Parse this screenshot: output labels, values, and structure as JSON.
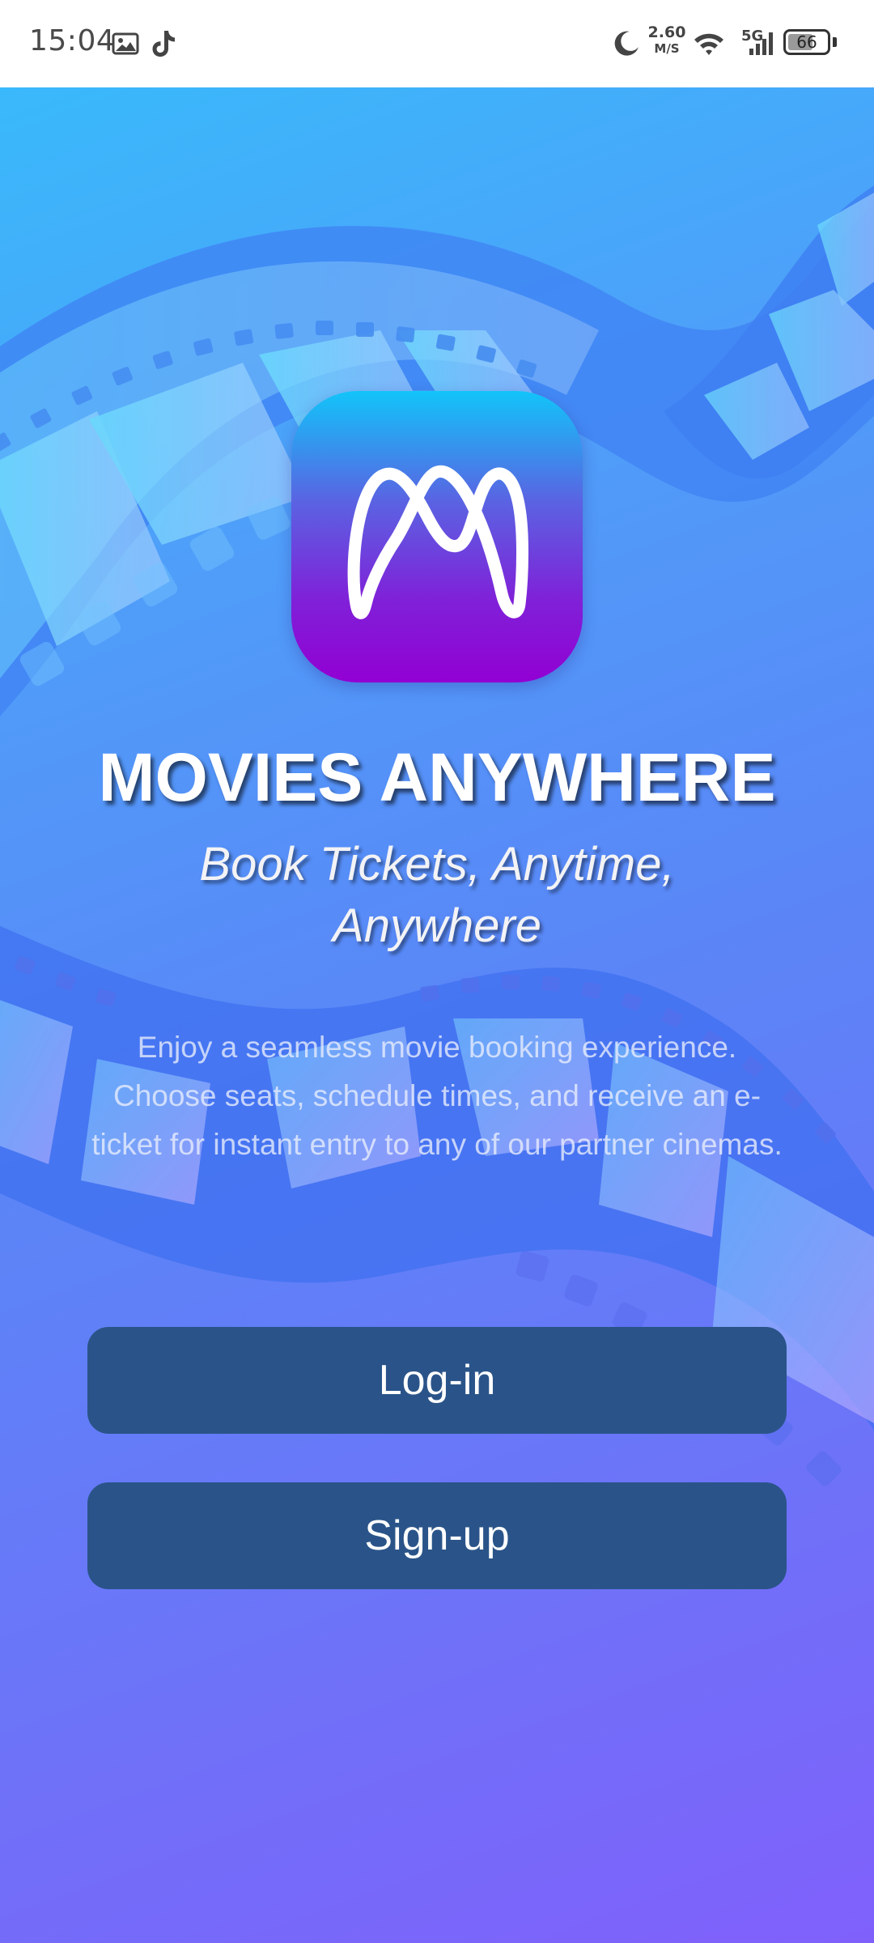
{
  "status_bar": {
    "time": "15:04",
    "net_speed_value": "2.60",
    "net_speed_unit": "M/S",
    "network_type": "5G",
    "battery_level": "66",
    "icons": [
      "photo-notification-icon",
      "tiktok-icon",
      "do-not-disturb-moon-icon",
      "wifi-icon",
      "cellular-signal-icon",
      "battery-icon"
    ]
  },
  "app": {
    "title": "MOVIES ANYWHERE",
    "tagline": "Book Tickets, Anytime, Anywhere",
    "description": "Enjoy a seamless movie booking experience. Choose seats, schedule times, and receive an e-ticket for instant entry to any of our partner cinemas.",
    "logo_icon": "movies-anywhere-logo-icon"
  },
  "buttons": {
    "login_label": "Log-in",
    "signup_label": "Sign-up"
  },
  "colors": {
    "button_bg": "#2a5489",
    "gradient_top": "#39b9fb",
    "gradient_bottom": "#8060fb",
    "logo_top": "#12c4f9",
    "logo_bottom": "#9200d3"
  }
}
